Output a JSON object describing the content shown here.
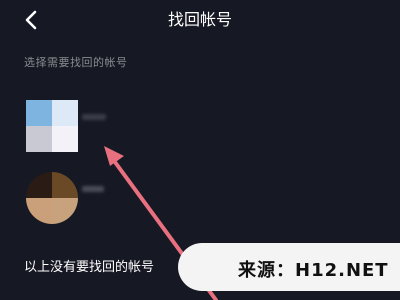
{
  "header": {
    "title": "找回帐号",
    "back_icon": "chevron-left-icon"
  },
  "subtitle": "选择需要找回的帐号",
  "accounts": [
    {
      "avatar_colors": [
        "#7eb4e0",
        "#dde9f6",
        "#c9c9d4",
        "#f2f2f8"
      ],
      "name_color": "#3b3d48"
    },
    {
      "avatar_colors": [
        "#2a1c14",
        "#6a4a26",
        "#caa07a",
        "#c8a27c"
      ],
      "name_color": "#4a4c56"
    }
  ],
  "no_account_label": "以上没有要找回的帐号",
  "watermark": "来源：H12.NET",
  "colors": {
    "background": "#161823",
    "arrow": "#e8707f",
    "watermark_bg": "#f4f4f4"
  }
}
